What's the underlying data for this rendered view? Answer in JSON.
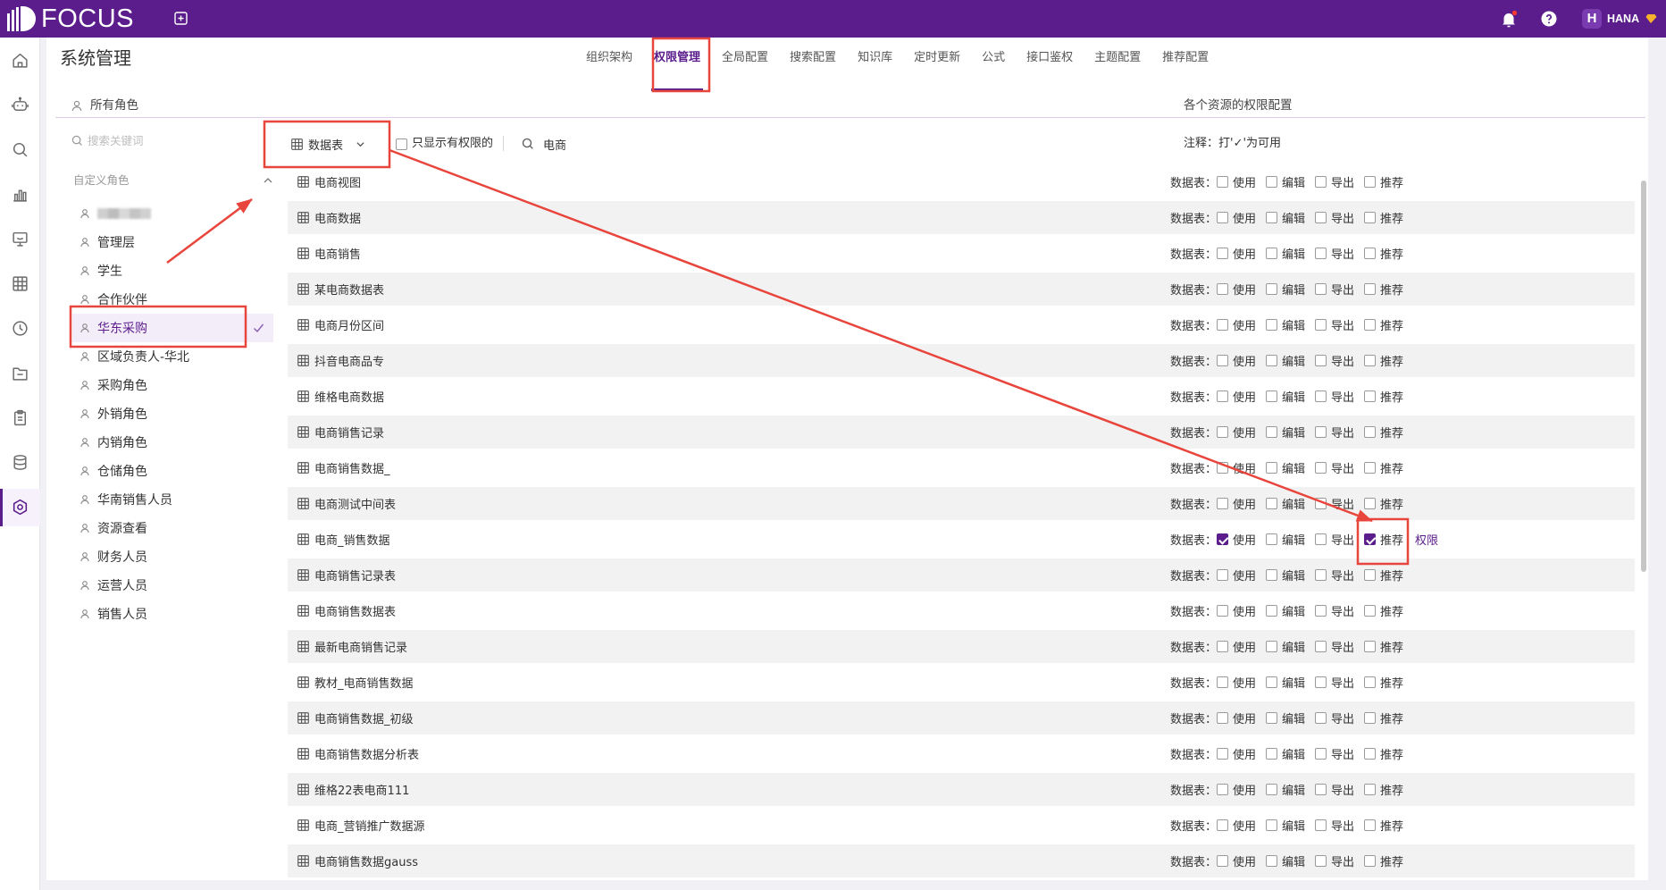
{
  "colors": {
    "brand": "#5b1d8c",
    "annotation": "#e8453c",
    "notification_dot": "#ff3b30"
  },
  "topbar": {
    "logo_text": "FOCUS",
    "avatar_letter": "H",
    "user_name": "HANA",
    "icons": [
      "focus-logo-icon",
      "add-icon",
      "bell-icon",
      "help-icon",
      "diamond-icon"
    ]
  },
  "sidebar": {
    "icons": [
      "home-icon",
      "robot-icon",
      "search-icon",
      "chart-icon",
      "dashboard-icon",
      "table-icon",
      "clock-icon",
      "folder-icon",
      "clipboard-icon",
      "database-icon",
      "settings-icon"
    ],
    "active_icon": "settings-icon"
  },
  "header": {
    "title": "系统管理",
    "tabs": [
      {
        "label": "组织架构"
      },
      {
        "label": "权限管理",
        "active": true
      },
      {
        "label": "全局配置"
      },
      {
        "label": "搜索配置"
      },
      {
        "label": "知识库"
      },
      {
        "label": "定时更新"
      },
      {
        "label": "公式"
      },
      {
        "label": "接口鉴权"
      },
      {
        "label": "主题配置"
      },
      {
        "label": "推荐配置"
      }
    ]
  },
  "roles_panel": {
    "title": "所有角色",
    "search_placeholder": "搜索关键词",
    "group_label": "自定义角色",
    "group_expanded": true,
    "roles": [
      {
        "label": "",
        "redacted": true
      },
      {
        "label": "管理层"
      },
      {
        "label": "学生"
      },
      {
        "label": "合作伙伴"
      },
      {
        "label": "华东采购",
        "selected": true
      },
      {
        "label": "区域负责人-华北"
      },
      {
        "label": "采购角色"
      },
      {
        "label": "外销角色"
      },
      {
        "label": "内销角色"
      },
      {
        "label": "仓储角色"
      },
      {
        "label": "华南销售人员"
      },
      {
        "label": "资源查看"
      },
      {
        "label": "财务人员"
      },
      {
        "label": "运营人员"
      },
      {
        "label": "销售人员"
      }
    ]
  },
  "resources_panel": {
    "title": "各个资源的权限配置",
    "type_select": "数据表",
    "only_permitted_label": "只显示有权限的",
    "only_permitted_checked": false,
    "search_value": "电商",
    "note": "注释：打'✓'为可用",
    "row_type_label": "数据表：",
    "permission_labels": [
      "使用",
      "编辑",
      "导出",
      "推荐"
    ],
    "detail_link_label": "权限",
    "rows": [
      {
        "name": "电商视图",
        "perms": [
          false,
          false,
          false,
          false
        ]
      },
      {
        "name": "电商数据",
        "perms": [
          false,
          false,
          false,
          false
        ]
      },
      {
        "name": "电商销售",
        "perms": [
          false,
          false,
          false,
          false
        ]
      },
      {
        "name": "某电商数据表",
        "perms": [
          false,
          false,
          false,
          false
        ]
      },
      {
        "name": "电商月份区间",
        "perms": [
          false,
          false,
          false,
          false
        ]
      },
      {
        "name": "抖音电商品专",
        "perms": [
          false,
          false,
          false,
          false
        ]
      },
      {
        "name": "维格电商数据",
        "perms": [
          false,
          false,
          false,
          false
        ]
      },
      {
        "name": "电商销售记录",
        "perms": [
          false,
          false,
          false,
          false
        ]
      },
      {
        "name": "电商销售数据_",
        "perms": [
          false,
          false,
          false,
          false
        ]
      },
      {
        "name": "电商测试中间表",
        "perms": [
          false,
          false,
          false,
          false
        ]
      },
      {
        "name": "电商_销售数据",
        "perms": [
          true,
          false,
          false,
          true
        ],
        "show_detail_link": true
      },
      {
        "name": "电商销售记录表",
        "perms": [
          false,
          false,
          false,
          false
        ]
      },
      {
        "name": "电商销售数据表",
        "perms": [
          false,
          false,
          false,
          false
        ]
      },
      {
        "name": "最新电商销售记录",
        "perms": [
          false,
          false,
          false,
          false
        ]
      },
      {
        "name": "教材_电商销售数据",
        "perms": [
          false,
          false,
          false,
          false
        ]
      },
      {
        "name": "电商销售数据_初级",
        "perms": [
          false,
          false,
          false,
          false
        ]
      },
      {
        "name": "电商销售数据分析表",
        "perms": [
          false,
          false,
          false,
          false
        ]
      },
      {
        "name": "维格22表电商111",
        "perms": [
          false,
          false,
          false,
          false
        ]
      },
      {
        "name": "电商_营销推广数据源",
        "perms": [
          false,
          false,
          false,
          false
        ]
      },
      {
        "name": "电商销售数据gauss",
        "perms": [
          false,
          false,
          false,
          false
        ]
      }
    ]
  }
}
